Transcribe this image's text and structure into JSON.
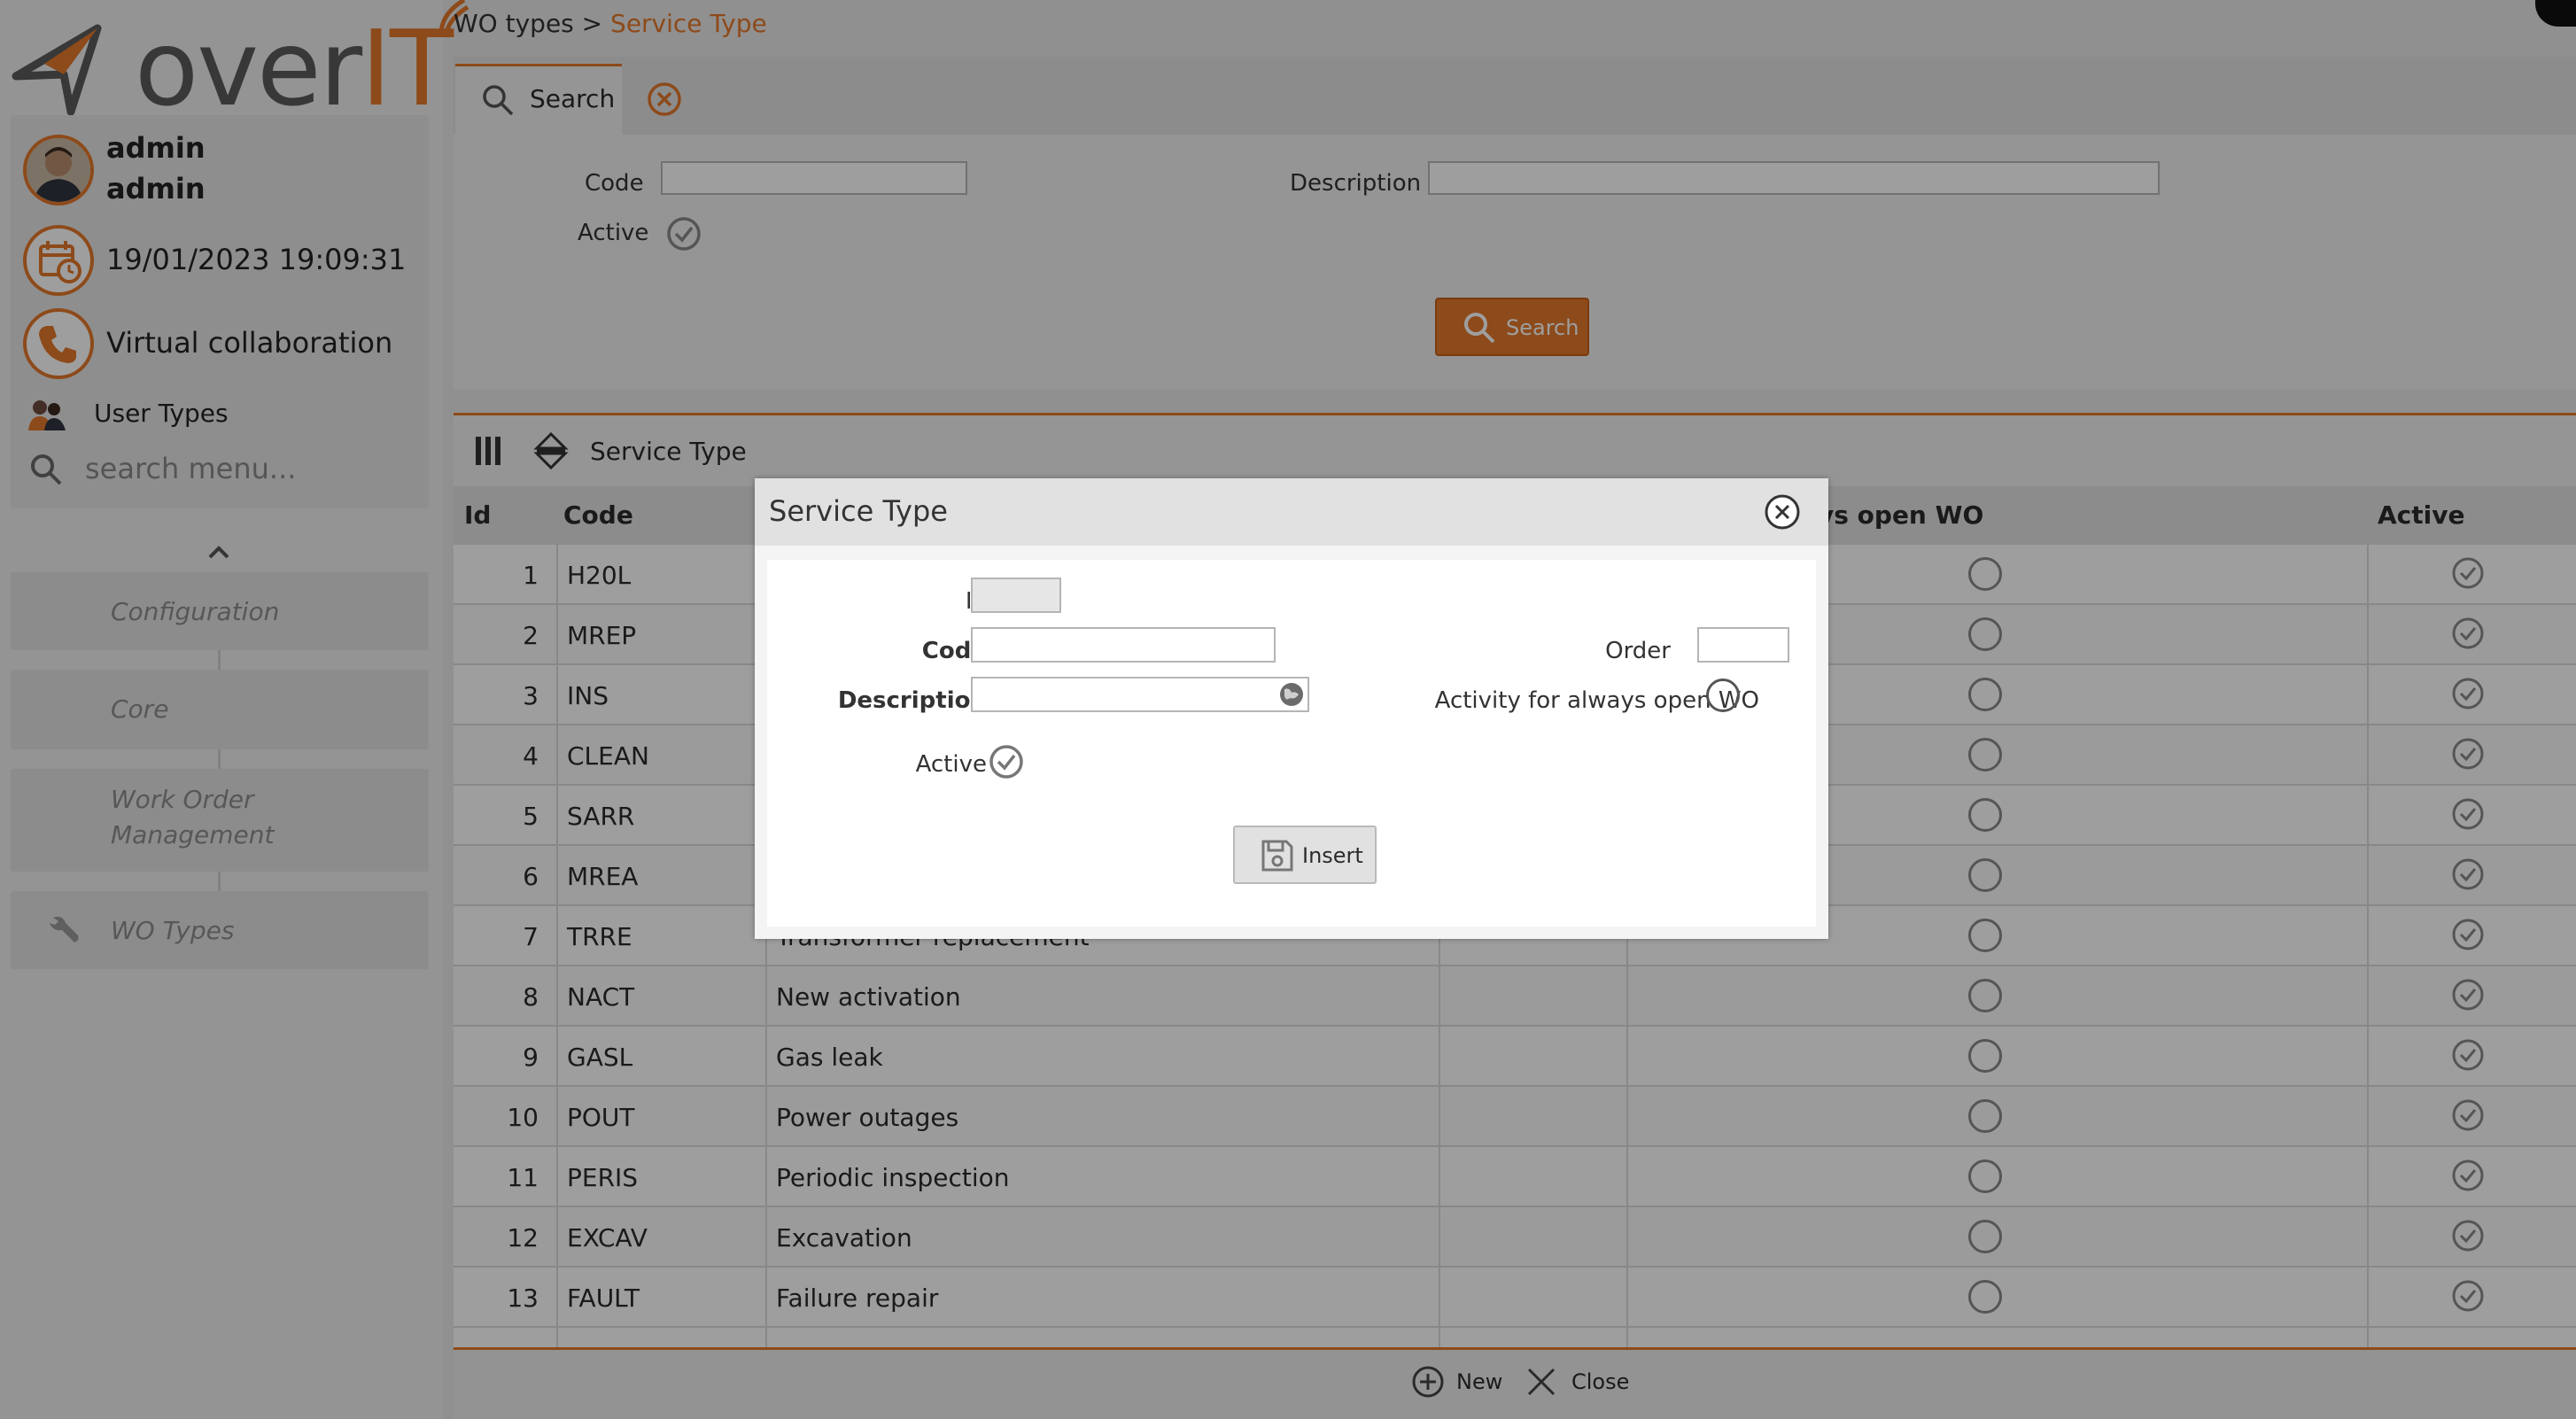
{
  "breadcrumb": {
    "parent": "WO types",
    "separator": ">",
    "current": "Service Type"
  },
  "logo": {
    "text_over": "over",
    "text_it": "IT"
  },
  "user": {
    "first": "admin",
    "second": "admin",
    "datetime": "19/01/2023 19:09:31",
    "collab": "Virtual collaboration",
    "user_types": "User Types"
  },
  "sidebar": {
    "search_placeholder": "search menu...",
    "items": [
      {
        "label": "Configuration"
      },
      {
        "label": "Core"
      },
      {
        "label_line1": "Work Order",
        "label_line2": "Management"
      },
      {
        "label": "WO Types"
      }
    ]
  },
  "search_panel": {
    "tab_label": "Search",
    "code_label": "Code",
    "code_value": "",
    "description_label": "Description",
    "description_value": "",
    "active_label": "Active",
    "active_checked": true,
    "search_button": "Search"
  },
  "grid": {
    "title": "Service Type",
    "columns": {
      "id": "Id",
      "code": "Code",
      "always_open": "ys open WO",
      "active": "Active"
    },
    "rows": [
      {
        "id": "1",
        "code": "H20L",
        "desc": ""
      },
      {
        "id": "2",
        "code": "MREP",
        "desc": ""
      },
      {
        "id": "3",
        "code": "INS",
        "desc": ""
      },
      {
        "id": "4",
        "code": "CLEAN",
        "desc": ""
      },
      {
        "id": "5",
        "code": "SARR",
        "desc": ""
      },
      {
        "id": "6",
        "code": "MREA",
        "desc": ""
      },
      {
        "id": "7",
        "code": "TRRE",
        "desc": "Transformer replacement"
      },
      {
        "id": "8",
        "code": "NACT",
        "desc": "New activation"
      },
      {
        "id": "9",
        "code": "GASL",
        "desc": "Gas leak"
      },
      {
        "id": "10",
        "code": "POUT",
        "desc": "Power outages"
      },
      {
        "id": "11",
        "code": "PERIS",
        "desc": "Periodic inspection"
      },
      {
        "id": "12",
        "code": "EXCAV",
        "desc": "Excavation"
      },
      {
        "id": "13",
        "code": "FAULT",
        "desc": "Failure repair"
      }
    ]
  },
  "footer": {
    "new_label": "New",
    "close_label": "Close"
  },
  "dialog": {
    "title": "Service Type",
    "id_label": "Id",
    "code_label": "Code",
    "description_label": "Description",
    "active_label": "Active",
    "order_label": "Order",
    "always_open_label": "Activity for always open WO",
    "insert_label": "Insert",
    "id_value": "",
    "code_value": "",
    "description_value": "",
    "order_value": ""
  },
  "colors": {
    "accent": "#e4782a",
    "overlay": "rgba(0,0,0,0.38)"
  }
}
